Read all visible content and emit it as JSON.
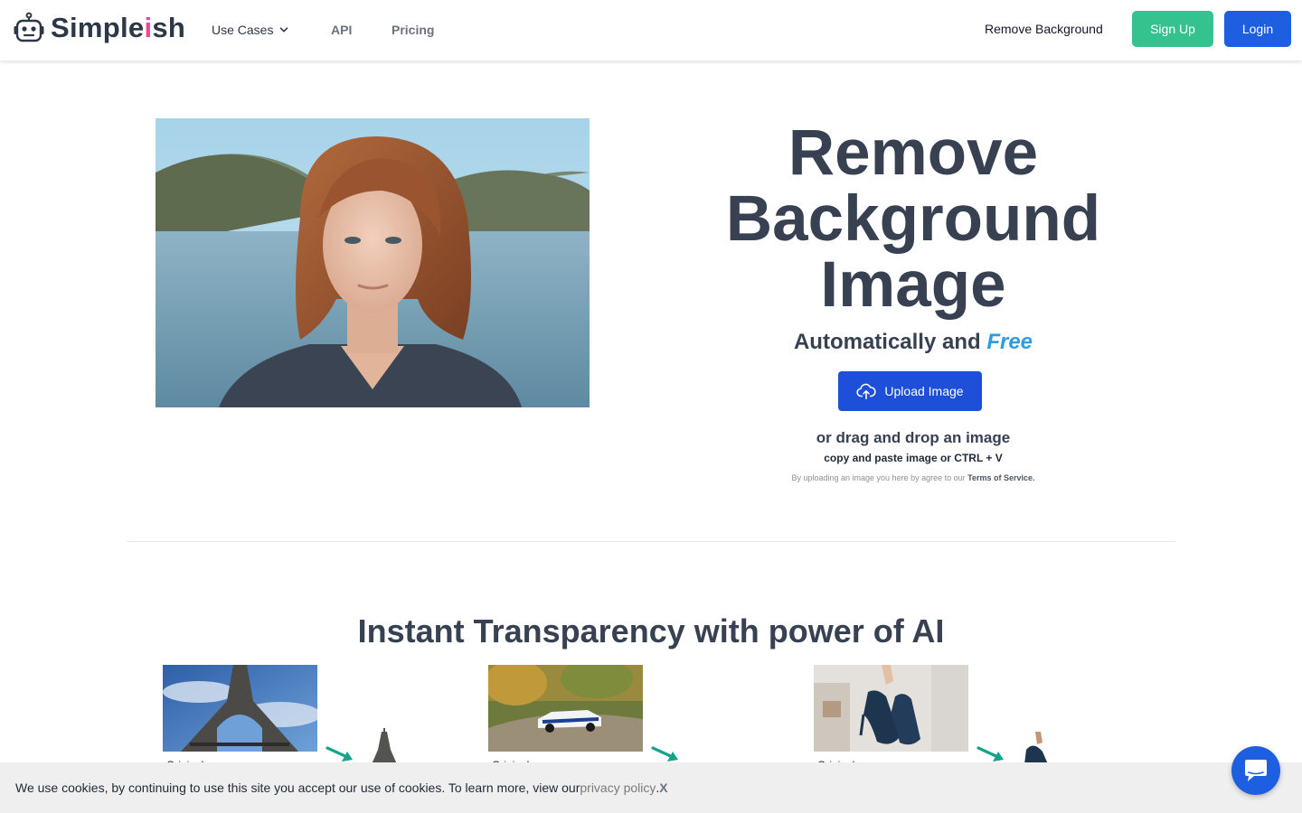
{
  "nav": {
    "logo_prefix": "Simple",
    "logo_accent": "i",
    "logo_suffix": "sh",
    "use_cases": "Use Cases",
    "api": "API",
    "pricing": "Pricing",
    "remove_background": "Remove Background",
    "sign_up": "Sign Up",
    "login": "Login"
  },
  "hero": {
    "title_line1": "Remove",
    "title_line2": "Background",
    "title_line3": "Image",
    "subtitle_prefix": "Automatically and ",
    "subtitle_accent": "Free",
    "upload_button": "Upload Image",
    "drag_text": "or drag and drop an image",
    "paste_text": "copy and paste image or CTRL + V",
    "tos_prefix": "By uploading an image you here by agree to our ",
    "tos_link": "Terms of Service."
  },
  "section": {
    "title": "Instant Transparency with power of AI"
  },
  "examples": [
    {
      "label": "Original"
    },
    {
      "label": "Original"
    },
    {
      "label": "Original"
    }
  ],
  "cookie": {
    "text": "We use cookies, by continuing to use this site you accept our use of cookies. To learn more, view our ",
    "link": "privacy policy",
    "period": ".",
    "close": "X"
  },
  "colors": {
    "brand_accent": "#ec4899",
    "signup": "#34c38f",
    "login": "#1d5fe0",
    "upload": "#1d4fd8",
    "free_text": "#2b9be3",
    "arrow": "#14a38b"
  }
}
